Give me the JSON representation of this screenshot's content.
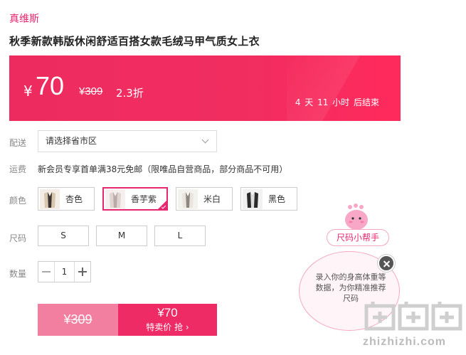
{
  "brand": "真维斯",
  "product_title": "秋季新款韩版休闲舒适百搭女款毛绒马甲气质女上衣",
  "price": {
    "currency": "¥",
    "current": "70",
    "original_currency": "¥",
    "original": "309",
    "discount": "2.3折",
    "countdown": "4 天 11 小时 后结束",
    "banner_color": "#ee2b5f"
  },
  "labels": {
    "delivery": "配送",
    "shipping": "运费",
    "color": "颜色",
    "size": "尺码",
    "quantity": "数量"
  },
  "delivery": {
    "placeholder": "请选择省市区"
  },
  "shipping_text": "新会员专享首单满38元免邮（限唯品自营商品，部分商品不可用）",
  "colors": [
    {
      "label": "杏色",
      "selected": false
    },
    {
      "label": "香芋紫",
      "selected": true
    },
    {
      "label": "米白",
      "selected": false
    },
    {
      "label": "黑色",
      "selected": false
    }
  ],
  "sizes": [
    "S",
    "M",
    "L"
  ],
  "quantity": "1",
  "buy": {
    "original_currency": "¥",
    "original": "309",
    "current": "¥70",
    "action_label": "特卖价 抢 ›"
  },
  "size_helper": {
    "button_label": "尺码小帮手",
    "bubble_text": "录入你的身高体重等数据，为你精准推荐尺码"
  },
  "watermark": {
    "text": "zhizhizhi.com"
  },
  "accent_color": "#e6266e"
}
